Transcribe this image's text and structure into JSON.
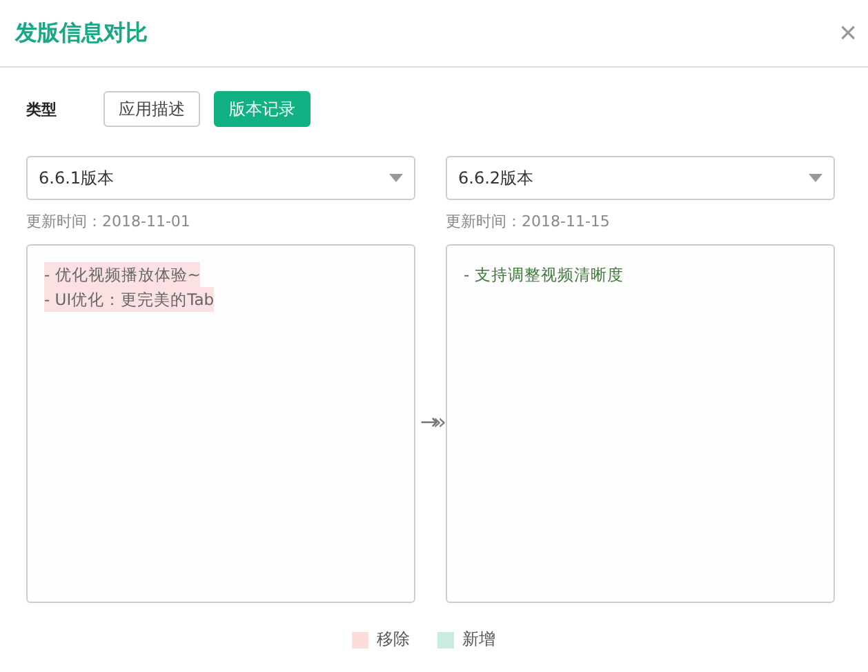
{
  "dialog": {
    "title": "发版信息对比",
    "close": "×"
  },
  "type_filter": {
    "label": "类型",
    "options": [
      {
        "label": "应用描述",
        "selected": false
      },
      {
        "label": "版本记录",
        "selected": true
      }
    ]
  },
  "arrow": "→»",
  "versions": [
    {
      "select": "6.6.1版本",
      "updated": "更新时间：2018-11-01",
      "lines": [
        {
          "text": "- 优化视频播放体验~",
          "kind": "removed"
        },
        {
          "text": "- UI优化：更完美的Tab",
          "kind": "removed"
        }
      ]
    },
    {
      "select": "6.6.2版本",
      "updated": "更新时间：2018-11-15",
      "lines": [
        {
          "text": "- 支持调整视频清晰度",
          "kind": "added"
        }
      ]
    }
  ],
  "legend": [
    {
      "label": "移除",
      "color": "#fbdddd"
    },
    {
      "label": "新增",
      "color": "#c9ece1"
    }
  ]
}
